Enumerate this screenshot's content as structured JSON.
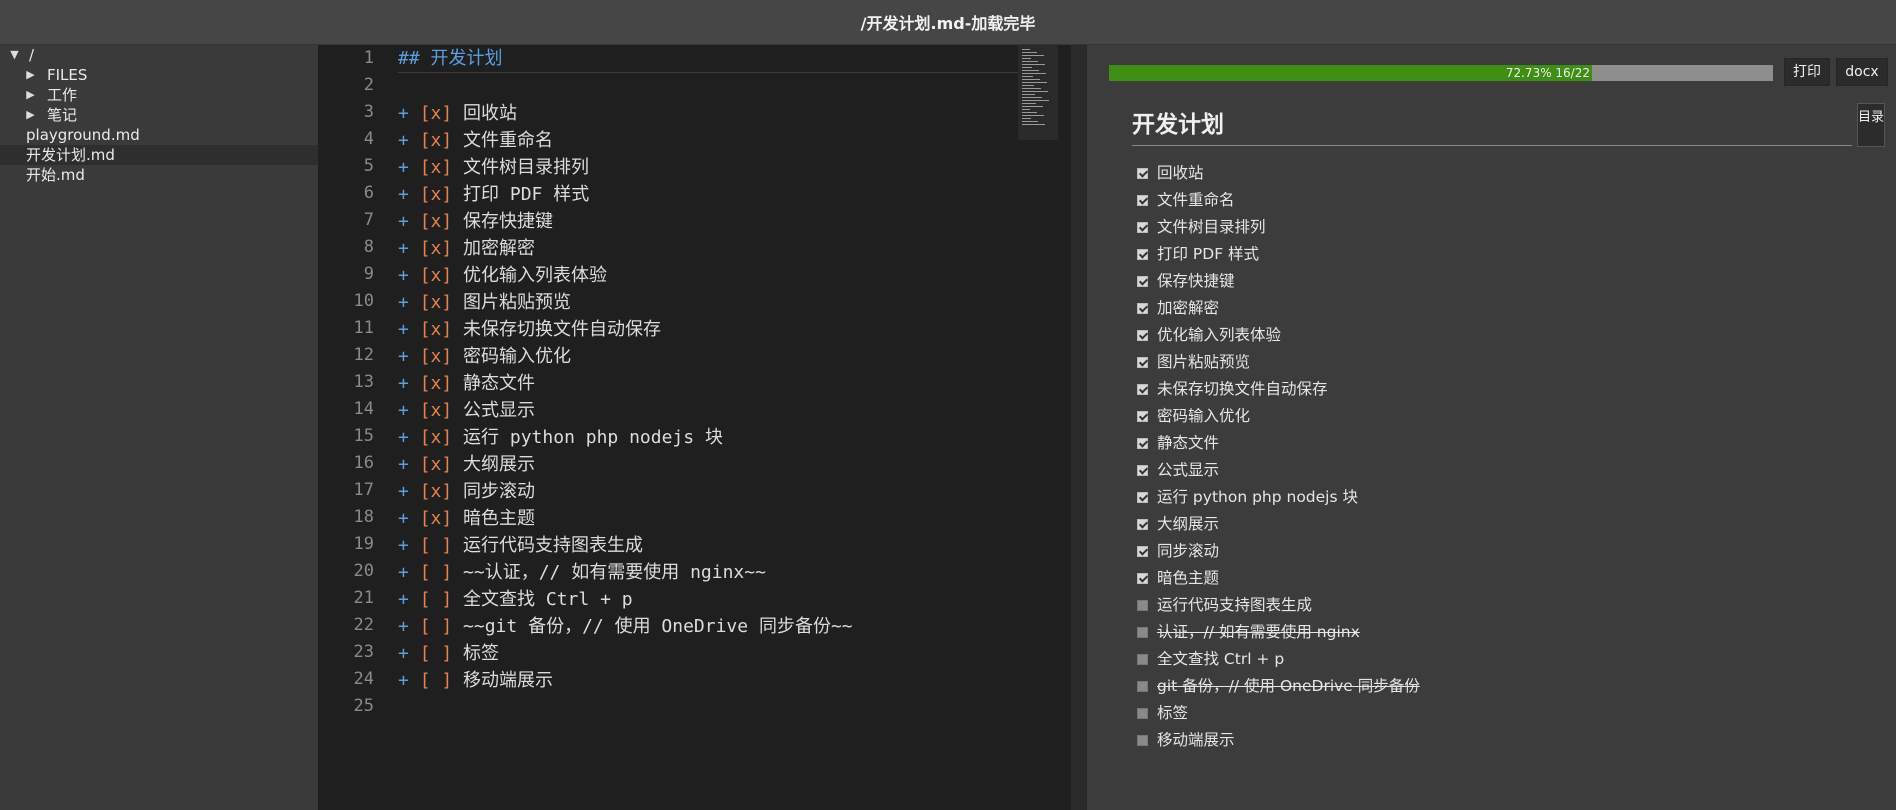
{
  "title": "/开发计划.md-加载完毕",
  "sidebar": {
    "root": "/",
    "items": [
      {
        "label": "FILES",
        "type": "folder"
      },
      {
        "label": "工作",
        "type": "folder"
      },
      {
        "label": "笔记",
        "type": "folder"
      },
      {
        "label": "playground.md",
        "type": "file"
      },
      {
        "label": "开发计划.md",
        "type": "file",
        "selected": true
      },
      {
        "label": "开始.md",
        "type": "file"
      }
    ]
  },
  "editor": {
    "line_numbers": [
      "1",
      "2",
      "3",
      "4",
      "5",
      "6",
      "7",
      "8",
      "9",
      "10",
      "11",
      "12",
      "13",
      "14",
      "15",
      "16",
      "17",
      "18",
      "19",
      "20",
      "21",
      "22",
      "23",
      "24",
      "25"
    ],
    "heading": {
      "hashes": "##",
      "text": "开发计划"
    },
    "lines": [
      {
        "mark": "[x]",
        "text": "回收站"
      },
      {
        "mark": "[x]",
        "text": "文件重命名"
      },
      {
        "mark": "[x]",
        "text": "文件树目录排列"
      },
      {
        "mark": "[x]",
        "text": "打印 PDF 样式"
      },
      {
        "mark": "[x]",
        "text": "保存快捷键"
      },
      {
        "mark": "[x]",
        "text": "加密解密"
      },
      {
        "mark": "[x]",
        "text": "优化输入列表体验"
      },
      {
        "mark": "[x]",
        "text": "图片粘贴预览"
      },
      {
        "mark": "[x]",
        "text": "未保存切换文件自动保存"
      },
      {
        "mark": "[x]",
        "text": "密码输入优化"
      },
      {
        "mark": "[x]",
        "text": "静态文件"
      },
      {
        "mark": "[x]",
        "text": "公式显示"
      },
      {
        "mark": "[x]",
        "text": "运行 python php nodejs 块"
      },
      {
        "mark": "[x]",
        "text": "大纲展示"
      },
      {
        "mark": "[x]",
        "text": "同步滚动"
      },
      {
        "mark": "[x]",
        "text": "暗色主题"
      },
      {
        "mark": "[ ]",
        "text": "运行代码支持图表生成"
      },
      {
        "mark": "[ ]",
        "text": "~~认证，// 如有需要使用 nginx~~"
      },
      {
        "mark": "[ ]",
        "text": "全文查找 Ctrl + p"
      },
      {
        "mark": "[ ]",
        "text": "~~git 备份，// 使用 OneDrive 同步备份~~"
      },
      {
        "mark": "[ ]",
        "text": "标签"
      },
      {
        "mark": "[ ]",
        "text": "移动端展示"
      }
    ],
    "plus": "+"
  },
  "preview": {
    "progress": {
      "fraction": 0.7273,
      "label": "72.73% 16/22"
    },
    "print_button": "打印",
    "docx_button": "docx",
    "doc_title": "开发计划",
    "toc_label": "目录",
    "tasks": [
      {
        "text": "回收站",
        "done": true
      },
      {
        "text": "文件重命名",
        "done": true
      },
      {
        "text": "文件树目录排列",
        "done": true
      },
      {
        "text": "打印 PDF 样式",
        "done": true
      },
      {
        "text": "保存快捷键",
        "done": true
      },
      {
        "text": "加密解密",
        "done": true
      },
      {
        "text": "优化输入列表体验",
        "done": true
      },
      {
        "text": "图片粘贴预览",
        "done": true
      },
      {
        "text": "未保存切换文件自动保存",
        "done": true
      },
      {
        "text": "密码输入优化",
        "done": true
      },
      {
        "text": "静态文件",
        "done": true
      },
      {
        "text": "公式显示",
        "done": true
      },
      {
        "text": "运行 python php nodejs 块",
        "done": true
      },
      {
        "text": "大纲展示",
        "done": true
      },
      {
        "text": "同步滚动",
        "done": true
      },
      {
        "text": "暗色主题",
        "done": true
      },
      {
        "text": "运行代码支持图表生成",
        "done": false
      },
      {
        "text": "认证，// 如有需要使用 nginx",
        "done": false,
        "strike": true
      },
      {
        "text": "全文查找 Ctrl + p",
        "done": false
      },
      {
        "text": "git 备份，// 使用 OneDrive 同步备份",
        "done": false,
        "strike": true
      },
      {
        "text": "标签",
        "done": false
      },
      {
        "text": "移动端展示",
        "done": false
      }
    ]
  }
}
